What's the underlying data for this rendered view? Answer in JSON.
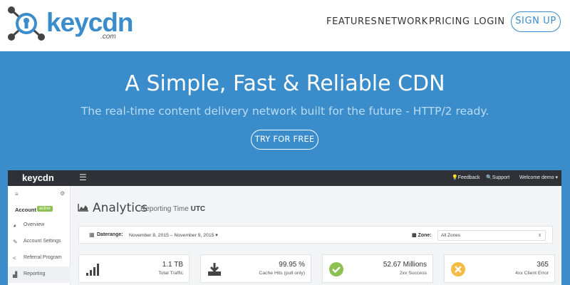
{
  "header": {
    "logo_text": "keycdn",
    "logo_sub": ".com",
    "nav": [
      "FEATURES",
      "NETWORK",
      "PRICING",
      "LOGIN"
    ],
    "signup_label": "SIGN UP"
  },
  "hero": {
    "title": "A Simple, Fast & Reliable CDN",
    "subtitle": "The real-time content delivery network built for the future - HTTP/2 ready.",
    "cta_label": "TRY FOR FREE"
  },
  "dashboard": {
    "logo_text": "keycdn",
    "topbar_links": [
      "Feedback",
      "Support",
      "Welcome demo ▾"
    ],
    "sidebar": {
      "account_label": "Account",
      "account_badge": "active",
      "items": [
        {
          "label": "Overview",
          "icon": "overview-icon"
        },
        {
          "label": "Account Settings",
          "icon": "edit-icon"
        },
        {
          "label": "Referral Program",
          "icon": "share-icon"
        },
        {
          "label": "Reporting",
          "icon": "reporting-icon"
        }
      ]
    },
    "page_title": "Analytics",
    "page_subtitle": "Reporting Time",
    "page_subtitle_tz": "UTC",
    "filter": {
      "daterange_label": "Daterange:",
      "daterange_value": "November 8, 2015 – November 9, 2015 ▾",
      "zone_label": "Zone:",
      "zone_value": "All Zones"
    },
    "cards": [
      {
        "value": "1.1 TB",
        "caption": "Total Traffic",
        "icon": "bar-chart-icon"
      },
      {
        "value": "99.95 %",
        "caption": "Cache Hits (pull only)",
        "icon": "download-icon"
      },
      {
        "value": "52.67 Millions",
        "caption": "2xx Success",
        "icon": "check-circle-icon"
      },
      {
        "value": "365",
        "caption": "4xx Client Error",
        "icon": "x-circle-icon"
      }
    ]
  },
  "colors": {
    "brand_blue": "#3a8ccb",
    "dark_bar": "#2f3136",
    "success_green": "#8cc152",
    "warning_yellow": "#f6bb42"
  }
}
